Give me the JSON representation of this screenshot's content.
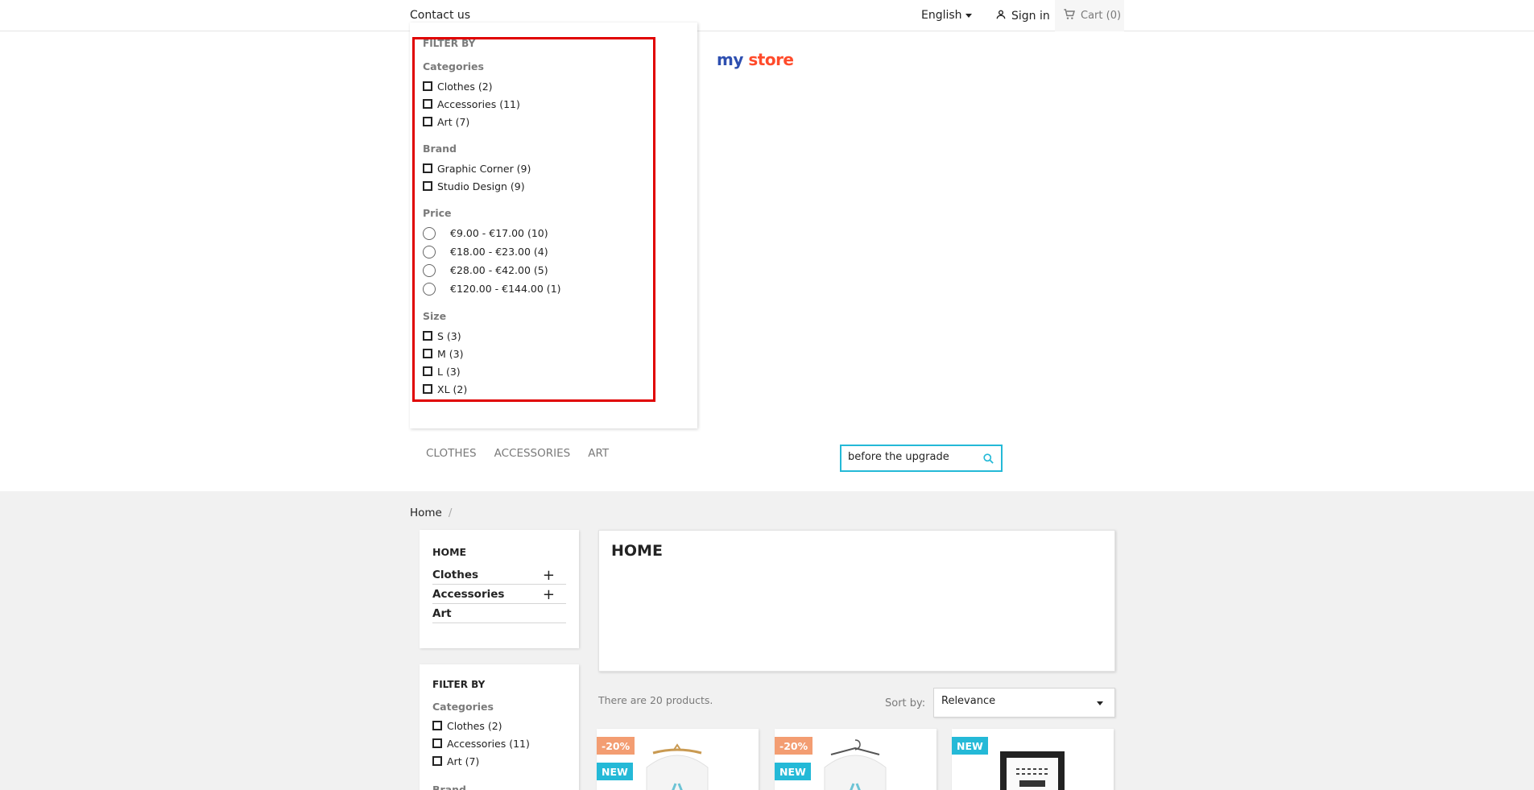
{
  "header": {
    "contact": "Contact us",
    "language": "English",
    "signin": "Sign in",
    "cart": "Cart (0)",
    "logo_part1": "my",
    "logo_part2": "store"
  },
  "nav": {
    "items": [
      "CLOTHES",
      "ACCESSORIES",
      "ART"
    ]
  },
  "search": {
    "value": "before the upgrade"
  },
  "dropdown_filter": {
    "title": "FILTER BY",
    "categories_title": "Categories",
    "categories": [
      "Clothes (2)",
      "Accessories (11)",
      "Art (7)"
    ],
    "brand_title": "Brand",
    "brands": [
      "Graphic Corner (9)",
      "Studio Design (9)"
    ],
    "price_title": "Price",
    "prices": [
      "€9.00 - €17.00 (10)",
      "€18.00 - €23.00 (4)",
      "€28.00 - €42.00 (5)",
      "€120.00 - €144.00 (1)"
    ],
    "size_title": "Size",
    "sizes": [
      "S (3)",
      "M (3)",
      "L (3)",
      "XL (2)"
    ]
  },
  "breadcrumb": {
    "home": "Home",
    "sep": "/"
  },
  "category_tree": {
    "title": "HOME",
    "items": [
      "Clothes",
      "Accessories",
      "Art"
    ]
  },
  "sidebar_filter": {
    "title": "FILTER BY",
    "categories_title": "Categories",
    "categories": [
      "Clothes (2)",
      "Accessories (11)",
      "Art (7)"
    ],
    "brand_title": "Brand"
  },
  "main": {
    "page_title": "HOME",
    "product_count": "There are 20 products.",
    "sort_label": "Sort by:",
    "sort_value": "Relevance"
  },
  "products": [
    {
      "discount": "-20%",
      "new": "NEW"
    },
    {
      "discount": "-20%",
      "new": "NEW"
    },
    {
      "new": "NEW"
    }
  ],
  "colors": {
    "accent": "#24b9d7",
    "discount": "#f39d72",
    "highlight": "#e00000"
  }
}
